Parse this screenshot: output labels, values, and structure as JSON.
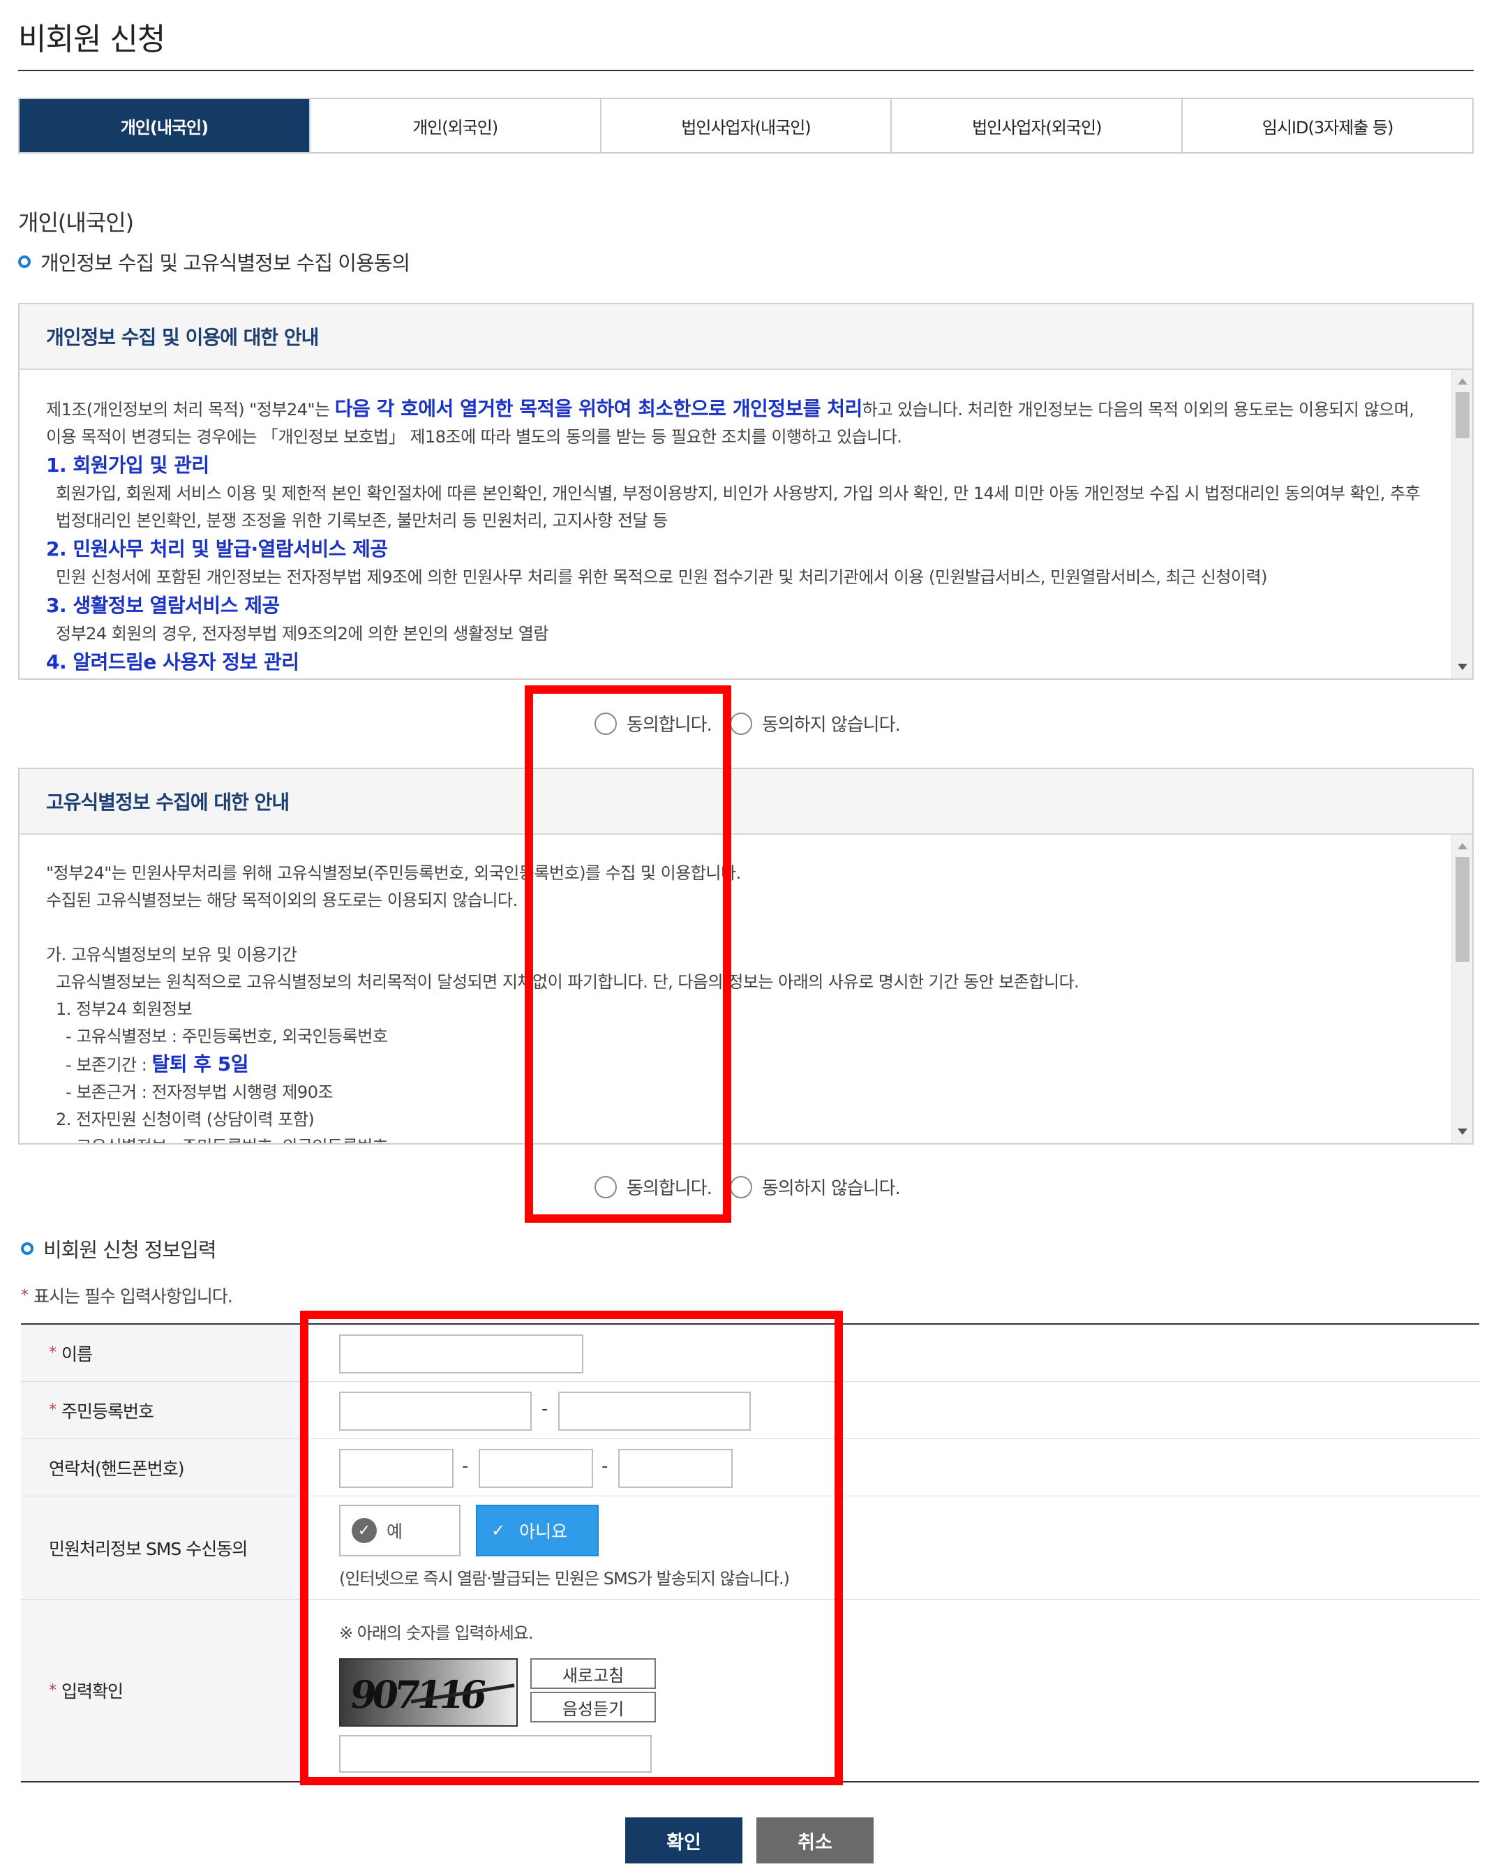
{
  "page": {
    "title": "비회원 신청"
  },
  "tabs": [
    {
      "label": "개인(내국인)",
      "active": true
    },
    {
      "label": "개인(외국인)",
      "active": false
    },
    {
      "label": "법인사업자(내국인)",
      "active": false
    },
    {
      "label": "법인사업자(외국인)",
      "active": false
    },
    {
      "label": "임시ID(3자제출 등)",
      "active": false
    }
  ],
  "section_label": "개인(내국인)",
  "consent_heading": "개인정보 수집 및 고유식별정보 수집 이용동의",
  "privacy_notice": {
    "title": "개인정보 수집 및 이용에 대한 안내",
    "p1_prefix": "제1조(개인정보의 처리 목적) \"정부24\"는 ",
    "p1_emphasis": "다음 각 호에서 열거한 목적을 위하여 최소한으로 개인정보를 처리",
    "p1_suffix": "하고 있습니다. 처리한 개인정보는 다음의 목적 이외의 용도로는 이용되지 않으며, 이용 목적이 변경되는 경우에는 「개인정보 보호법」 제18조에 따라 별도의 동의를 받는 등 필요한 조치를 이행하고 있습니다.",
    "item1_title": "1. 회원가입 및 관리",
    "item1_body": "회원가입, 회원제 서비스 이용 및 제한적 본인 확인절차에 따른 본인확인, 개인식별, 부정이용방지, 비인가 사용방지, 가입 의사 확인, 만 14세 미만 아동 개인정보 수집 시 법정대리인 동의여부 확인, 추후 법정대리인 본인확인, 분쟁 조정을 위한 기록보존, 불만처리 등 민원처리, 고지사항 전달 등",
    "item2_title": "2. 민원사무 처리 및 발급·열람서비스 제공",
    "item2_body": "민원 신청서에 포함된 개인정보는 전자정부법 제9조에 의한 민원사무 처리를 위한 목적으로 민원 접수기관 및 처리기관에서 이용 (민원발급서비스, 민원열람서비스, 최근 신청이력)",
    "item3_title": "3. 생활정보 열람서비스 제공",
    "item3_body": "정부24 회원의 경우, 전자정부법 제9조의2에 의한 본인의 생활정보 열람",
    "item4_title": "4. 알려드림e 사용자 정보 관리"
  },
  "consent1": {
    "agree": "동의합니다.",
    "disagree": "동의하지 않습니다."
  },
  "unique_notice": {
    "title": "고유식별정보 수집에 대한 안내",
    "line1": "\"정부24\"는 민원사무처리를 위해 고유식별정보(주민등록번호, 외국인등록번호)를 수집 및 이용합니다.",
    "line2": "수집된 고유식별정보는 해당 목적이외의 용도로는 이용되지 않습니다.",
    "line3": "가. 고유식별정보의 보유 및 이용기간",
    "line4": "고유식별정보는 원칙적으로 고유식별정보의 처리목적이 달성되면 지체없이 파기합니다. 단, 다음의 정보는 아래의 사유로 명시한 기간 동안 보존합니다.",
    "line5": "1. 정부24 회원정보",
    "line6": "- 고유식별정보 : 주민등록번호, 외국인등록번호",
    "line7_prefix": "- 보존기간 : ",
    "line7_emphasis": "탈퇴 후 5일",
    "line8": "- 보존근거 : 전자정부법 시행령 제90조",
    "line9": "2. 전자민원 신청이력 (상담이력 포함)",
    "line10": "- 고유식별정보 : 주민등록번호, 외국인등록번호"
  },
  "consent2": {
    "agree": "동의합니다.",
    "disagree": "동의하지 않습니다."
  },
  "form_heading": "비회원 신청 정보입력",
  "required_note": "표시는 필수 입력사항입니다.",
  "required_mark": "*",
  "form": {
    "name_label": "이름",
    "rrn_label": "주민등록번호",
    "phone_label": "연락처(핸드폰번호)",
    "sms_label": "민원처리정보 SMS 수신동의",
    "sms_yes": "예",
    "sms_no": "아니요",
    "sms_selected": "아니요",
    "sms_note": "(인터넷으로 즉시 열람·발급되는 민원은 SMS가 발송되지 않습니다.)",
    "captcha_label": "입력확인",
    "captcha_hint": "※ 아래의 숫자를 입력하세요.",
    "captcha_value": "907116",
    "refresh": "새로고침",
    "audio": "음성듣기",
    "dash": "-"
  },
  "buttons": {
    "confirm": "확인",
    "cancel": "취소"
  },
  "colors": {
    "primary": "#143b66",
    "accent_blue": "#2f9be9",
    "highlight": "#ff0000",
    "required": "#e0303a",
    "link_blue": "#1a33c4"
  },
  "icons": {
    "check": "check-icon",
    "bullet": "ring-bullet-icon"
  }
}
